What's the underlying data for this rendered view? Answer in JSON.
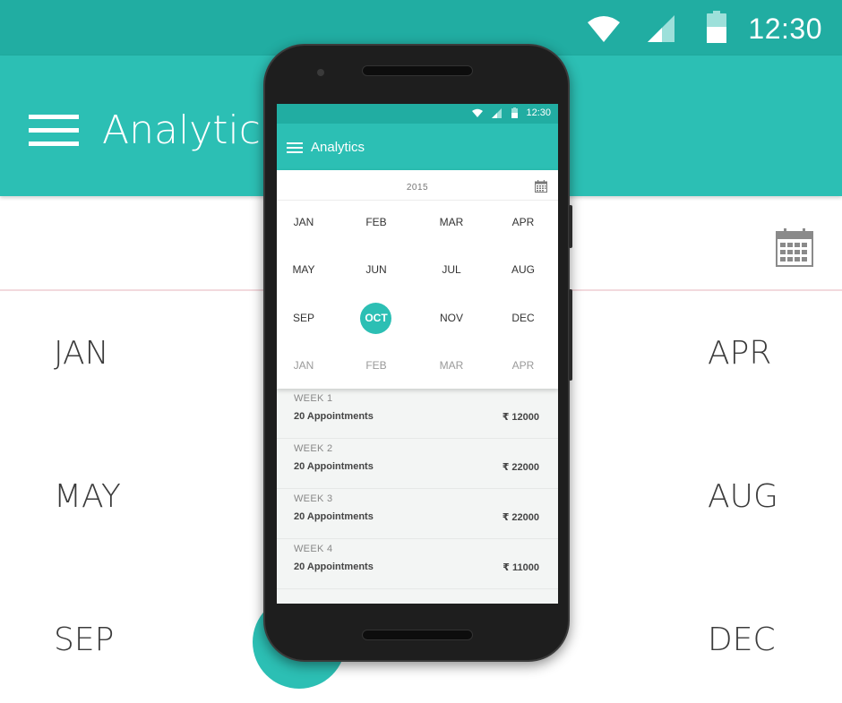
{
  "background": {
    "status_bar": {
      "time": "12:30",
      "icons": [
        "wifi-icon",
        "signal-icon",
        "battery-icon"
      ]
    },
    "app_bar": {
      "title": "Analytics",
      "menu_icon": "hamburger-icon"
    },
    "calendar_icon": "calendar-icon",
    "months": {
      "jan": "JAN",
      "apr": "APR",
      "may": "MAY",
      "aug": "AUG",
      "sep": "SEP",
      "dec": "DEC"
    }
  },
  "phone": {
    "status_bar": {
      "time": "12:30",
      "icons": [
        "wifi-icon",
        "signal-icon",
        "battery-icon"
      ]
    },
    "app_bar": {
      "title": "Analytics",
      "menu_icon": "hamburger-icon"
    },
    "picker": {
      "year": "2015",
      "calendar_icon": "calendar-icon",
      "months": [
        {
          "label": "JAN",
          "state": "normal"
        },
        {
          "label": "FEB",
          "state": "normal"
        },
        {
          "label": "MAR",
          "state": "normal"
        },
        {
          "label": "APR",
          "state": "normal"
        },
        {
          "label": "MAY",
          "state": "normal"
        },
        {
          "label": "JUN",
          "state": "normal"
        },
        {
          "label": "JUL",
          "state": "normal"
        },
        {
          "label": "AUG",
          "state": "normal"
        },
        {
          "label": "SEP",
          "state": "normal"
        },
        {
          "label": "OCT",
          "state": "selected"
        },
        {
          "label": "NOV",
          "state": "normal"
        },
        {
          "label": "DEC",
          "state": "normal"
        },
        {
          "label": "JAN",
          "state": "faded"
        },
        {
          "label": "FEB",
          "state": "faded"
        },
        {
          "label": "MAR",
          "state": "faded"
        },
        {
          "label": "APR",
          "state": "faded"
        }
      ]
    },
    "weeks": [
      {
        "label": "WEEK 1",
        "appointments": "20 Appointments",
        "amount": "₹ 12000"
      },
      {
        "label": "WEEK 2",
        "appointments": "20 Appointments",
        "amount": "₹ 22000"
      },
      {
        "label": "WEEK 3",
        "appointments": "20 Appointments",
        "amount": "₹ 22000"
      },
      {
        "label": "WEEK 4",
        "appointments": "20 Appointments",
        "amount": "₹ 11000"
      }
    ]
  },
  "colors": {
    "status_bar": "#21ada2",
    "app_bar": "#2cbfb4",
    "accent": "#2cbfb4"
  }
}
